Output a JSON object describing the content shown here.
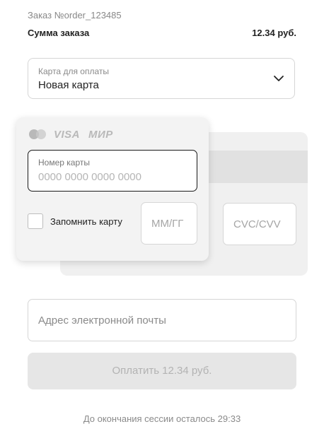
{
  "order": {
    "id_text": "Заказ №order_123485",
    "sum_label": "Сумма заказа",
    "sum_value": "12.34 руб."
  },
  "card_select": {
    "label": "Карта для оплаты",
    "value": "Новая карта",
    "icon": "chevron-down-icon"
  },
  "card_form": {
    "brands": {
      "mastercard_icon": "mastercard-icon",
      "visa": "VISA",
      "mir": "МИР"
    },
    "card_number": {
      "label": "Номер карты",
      "placeholder": "0000 0000 0000 0000",
      "value": ""
    },
    "remember": {
      "label": "Запомнить карту",
      "checked": false
    },
    "expiry": {
      "placeholder": "ММ/ГГ",
      "value": ""
    },
    "cvc": {
      "placeholder": "CVC/CVV",
      "value": ""
    }
  },
  "email": {
    "placeholder": "Адрес электронной почты",
    "value": ""
  },
  "pay_button": {
    "label": "Оплатить 12.34 руб.",
    "enabled": false
  },
  "session": {
    "text": "До окончания сессии осталось 29:33"
  },
  "colors": {
    "card_front": "#f3f3f3",
    "card_back": "#f0f0f0",
    "disabled_button": "#e6e6e6",
    "disabled_text": "#b3b3b3",
    "focus_border": "#1a1a1a"
  }
}
